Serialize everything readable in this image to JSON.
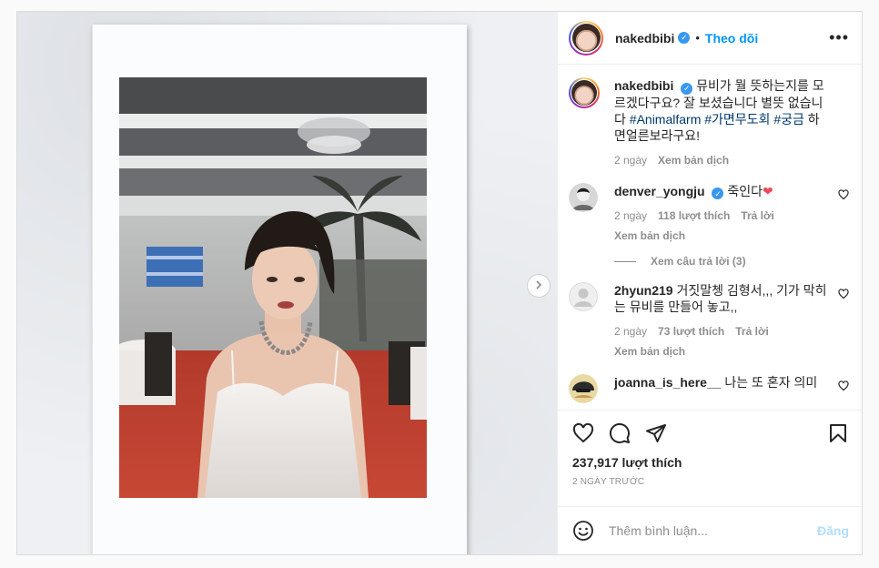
{
  "header": {
    "username": "nakedbibi",
    "separator": "•",
    "follow_label": "Theo dõi",
    "more_label": "•••"
  },
  "caption": {
    "username": "nakedbibi",
    "text_plain": "뮤비가 뭘 뜻하는지를 모르겠다구요? 잘 보셨습니다 별뜻 없습니다",
    "hashtags": "#Animalfarm #가면무도회 #궁금",
    "text_tail": "하면얼른보라구요!",
    "age": "2 ngày",
    "translate": "Xem bản dịch"
  },
  "comments": [
    {
      "username": "denver_yongju",
      "text": "죽인다",
      "emoji": "❤",
      "age": "2 ngày",
      "likes": "118 lượt thích",
      "reply": "Trả lời",
      "translate": "Xem bản dịch",
      "view_replies": "Xem câu trả lời (3)"
    },
    {
      "username": "2hyun219",
      "text": "거짓말쳉 김형서,,, 기가 막히는 뮤비를 만들어 놓고,,",
      "age": "2 ngày",
      "likes": "73 lượt thích",
      "reply": "Trả lời",
      "translate": "Xem bản dịch"
    },
    {
      "username": "joanna_is_here__",
      "text": "나는 또 혼자 의미"
    }
  ],
  "footer": {
    "likes": "237,917 lượt thích",
    "timestamp": "2 NGÀY TRƯỚC",
    "comment_placeholder": "Thêm bình luận...",
    "post_label": "Đăng"
  },
  "icons": {
    "heart": "heart-icon",
    "comment": "comment-icon",
    "share": "share-icon",
    "bookmark": "bookmark-icon",
    "emoji": "emoji-icon",
    "next": "chevron-right-icon"
  },
  "colors": {
    "accent": "#0095f6",
    "verified": "#3897f0",
    "like_red": "#ed4956",
    "muted": "#8e8e8e"
  }
}
